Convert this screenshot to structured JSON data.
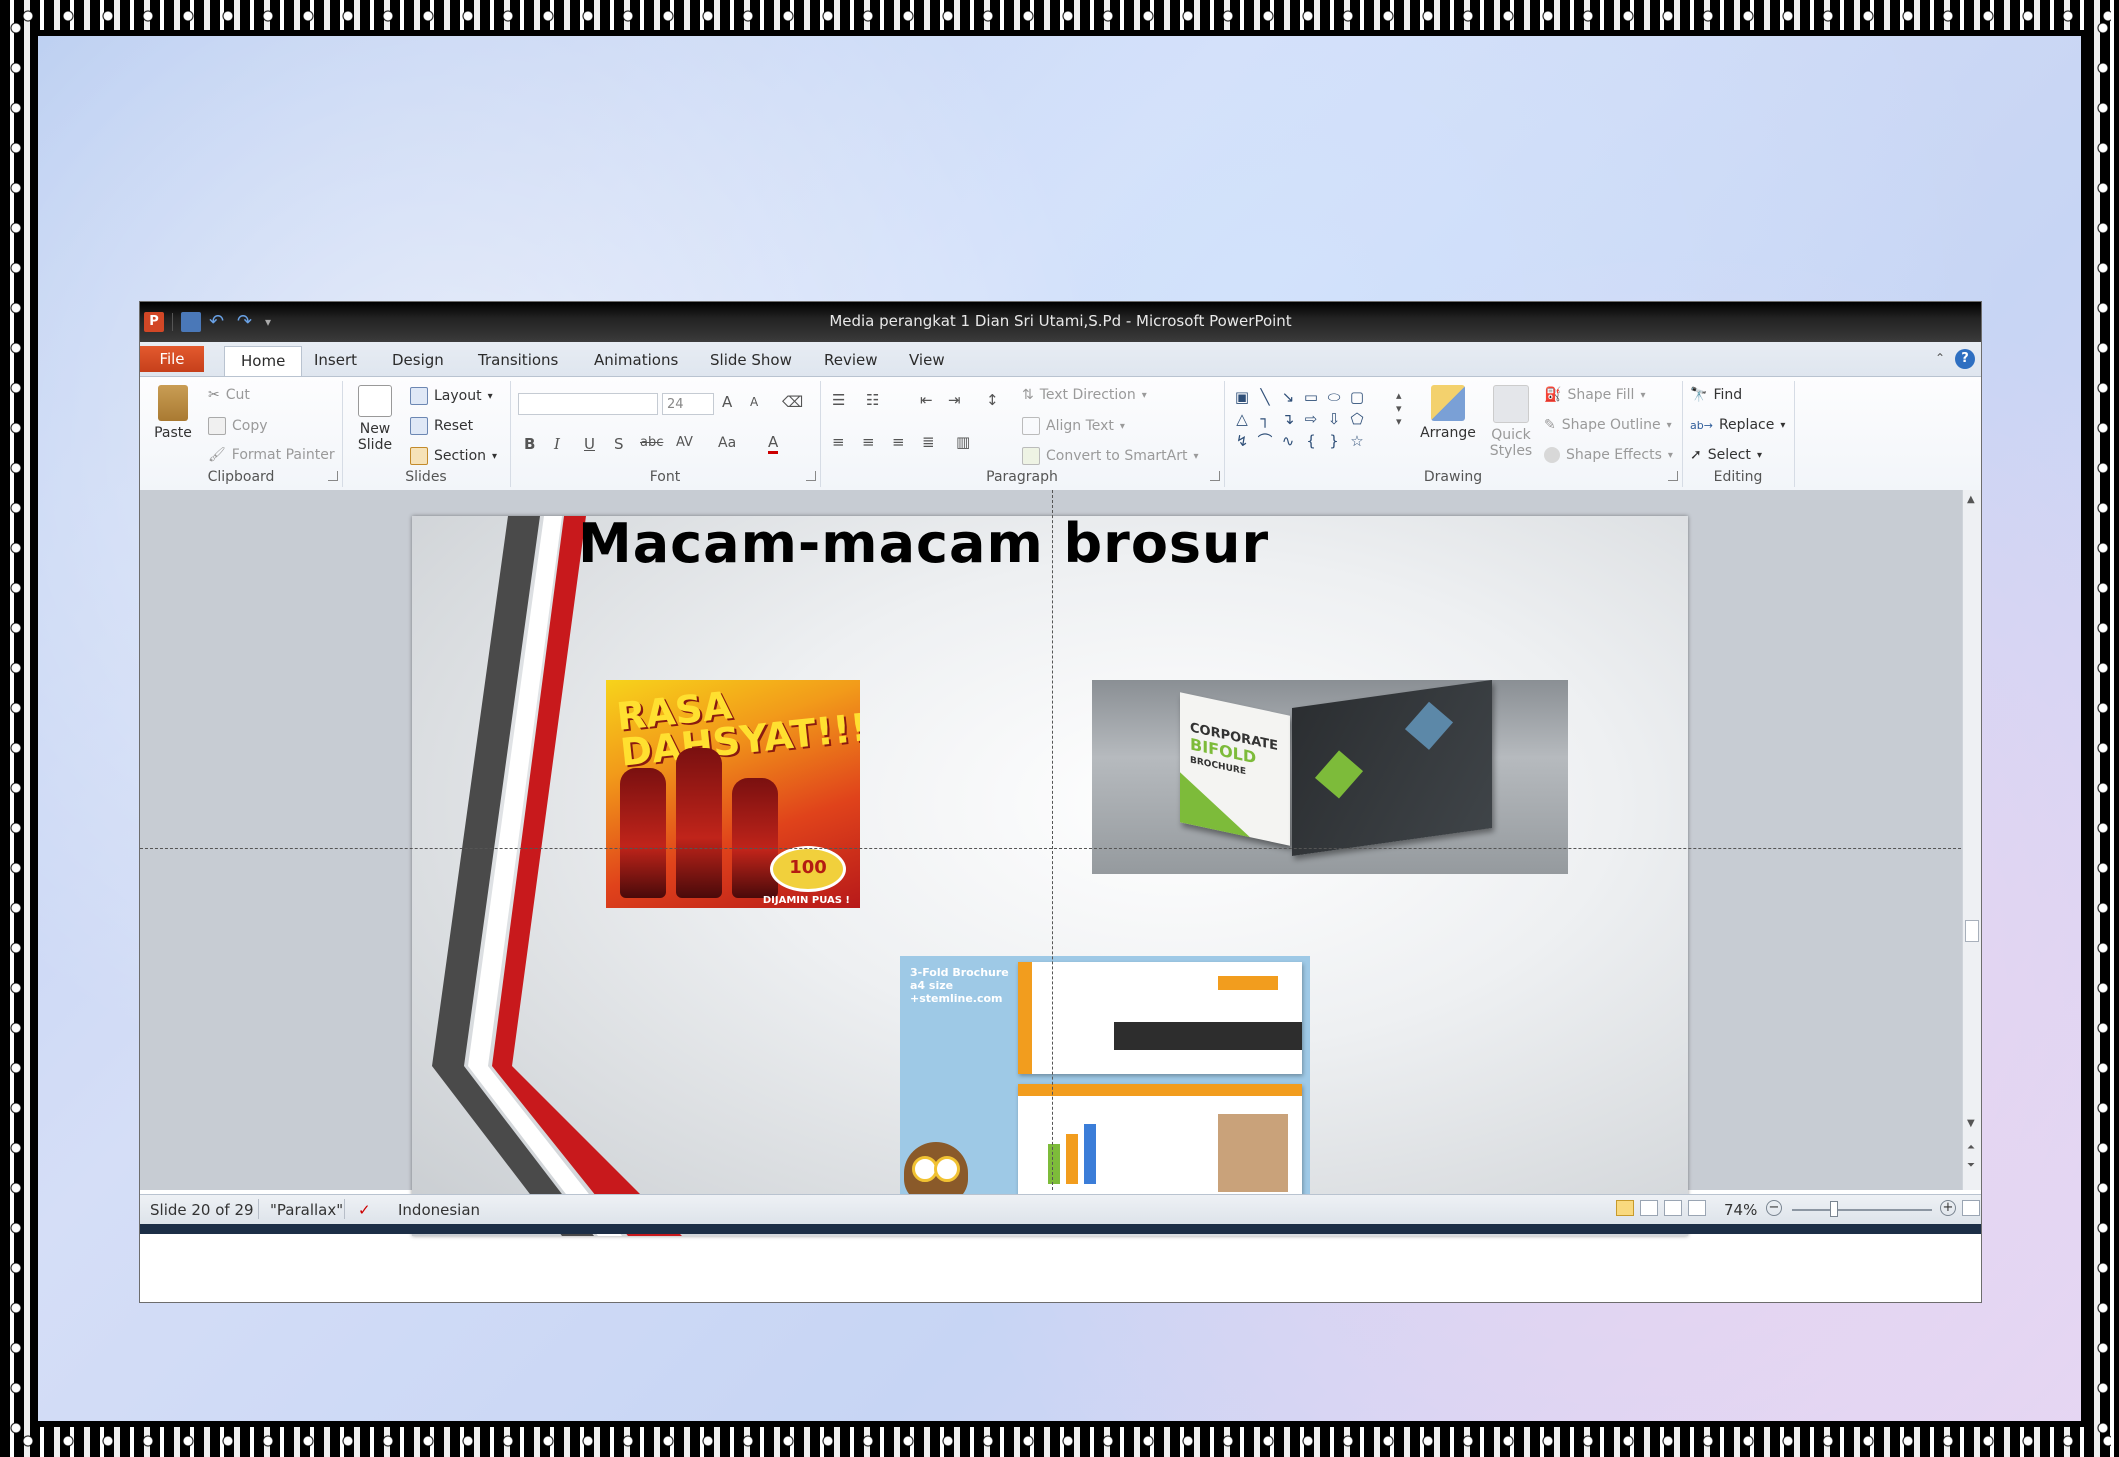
{
  "window": {
    "title": "Media perangkat 1 Dian Sri Utami,S.Pd  -  Microsoft PowerPoint",
    "app_icon": "P"
  },
  "tabs": [
    "File",
    "Home",
    "Insert",
    "Design",
    "Transitions",
    "Animations",
    "Slide Show",
    "Review",
    "View"
  ],
  "ribbon": {
    "clipboard": {
      "label": "Clipboard",
      "paste": "Paste",
      "cut": "Cut",
      "copy": "Copy",
      "format_painter": "Format Painter"
    },
    "slides": {
      "label": "Slides",
      "new_slide_line1": "New",
      "new_slide_line2": "Slide",
      "layout": "Layout",
      "reset": "Reset",
      "section": "Section"
    },
    "font": {
      "label": "Font",
      "font_name": "",
      "font_size": "24",
      "bold": "B",
      "italic": "I",
      "underline": "U",
      "shadow": "S",
      "strike": "abc",
      "spacing": "AV",
      "case": "Aa",
      "color": "A",
      "grow": "A",
      "shrink": "A"
    },
    "paragraph": {
      "label": "Paragraph",
      "text_direction": "Text Direction",
      "align_text": "Align Text",
      "convert_smartart": "Convert to SmartArt"
    },
    "drawing": {
      "label": "Drawing",
      "arrange": "Arrange",
      "quick_styles_line1": "Quick",
      "quick_styles_line2": "Styles",
      "shape_fill": "Shape Fill",
      "shape_outline": "Shape Outline",
      "shape_effects": "Shape Effects"
    },
    "editing": {
      "label": "Editing",
      "find": "Find",
      "replace": "Replace",
      "select": "Select"
    }
  },
  "slide": {
    "title": "Macam-macam brosur",
    "pic1": {
      "headline_1": "RASA",
      "headline_2": "DAHSYAT!!!",
      "badge": "100",
      "footer": "DIJAMIN PUAS !"
    },
    "pic2": {
      "line1": "CORPORATE",
      "line2": "BIFOLD",
      "line3": "BROCHURE"
    },
    "pic3": {
      "header_1": "3-Fold Brochure",
      "header_2": "a4 size",
      "header_3": "+stemline.com"
    }
  },
  "status": {
    "slide_counter": "Slide 20 of 29",
    "theme": "\"Parallax\"",
    "language": "Indonesian",
    "zoom": "74%"
  },
  "colors": {
    "file_tab": "#d24726",
    "accent_red": "#c8191c",
    "stripe_gray": "#4a4a4a"
  }
}
